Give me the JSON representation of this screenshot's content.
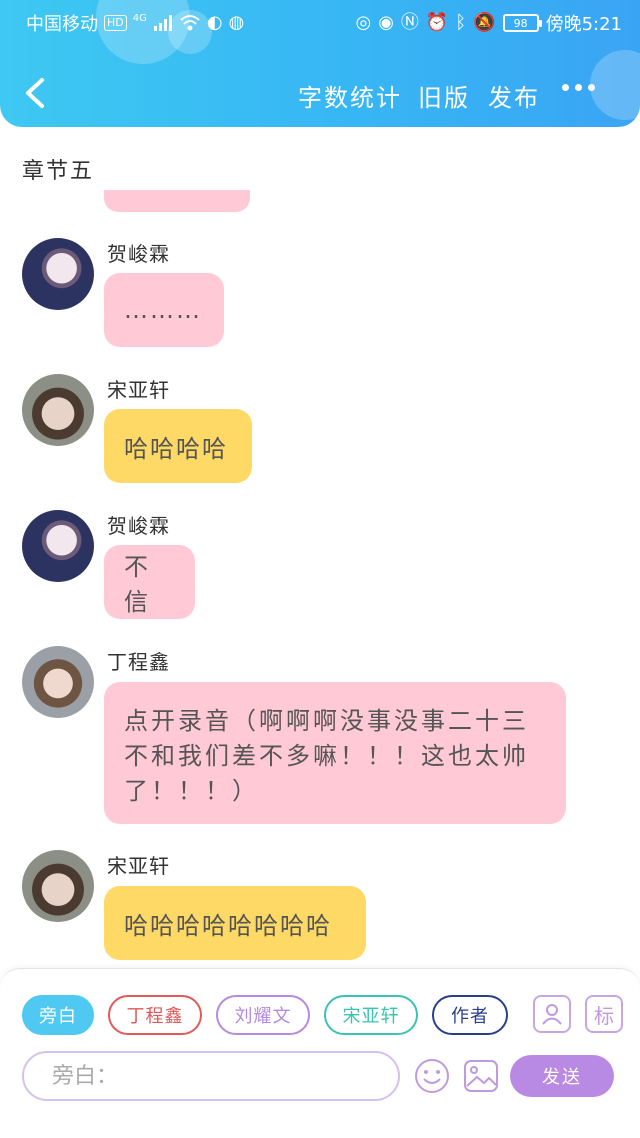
{
  "status_bar": {
    "carrier": "中国移动",
    "hd_label": "HD",
    "network_label": "4G",
    "battery": "98",
    "time": "傍晚5:21"
  },
  "header": {
    "word_count_label": "字数统计",
    "old_version_label": "旧版",
    "publish_label": "发布"
  },
  "chapter_title": "章节五",
  "messages": [
    {
      "sender": "贺峻霖",
      "text": "………",
      "style": "pink"
    },
    {
      "sender": "宋亚轩",
      "text": "哈哈哈哈",
      "style": "yellow"
    },
    {
      "sender": "贺峻霖",
      "text": "不信",
      "style": "pink"
    },
    {
      "sender": "丁程鑫",
      "lines": [
        "点开录音（啊啊啊没事没事二十三",
        "不和我们差不多嘛！！！这也太帅",
        "了！！！）"
      ],
      "style": "pink"
    },
    {
      "sender": "宋亚轩",
      "text": "哈哈哈哈哈哈哈哈",
      "style": "yellow"
    }
  ],
  "role_tags": [
    {
      "label": "旁白",
      "color": "#4fc8f2",
      "selected": true
    },
    {
      "label": "丁程鑫",
      "color": "#e05a5a",
      "selected": false
    },
    {
      "label": "刘耀文",
      "color": "#b58ae0",
      "selected": false
    },
    {
      "label": "宋亚轩",
      "color": "#3cc2b4",
      "selected": false
    },
    {
      "label": "作者",
      "color": "#2a3f8a",
      "selected": false
    }
  ],
  "tag_button_label": "标",
  "input": {
    "placeholder": "旁白："
  },
  "send_label": "发送",
  "colors": {
    "header": "#3bb8f4",
    "pink_bubble": "#ffc9d5",
    "yellow_bubble": "#ffd965",
    "accent_purple": "#b98ae3"
  }
}
